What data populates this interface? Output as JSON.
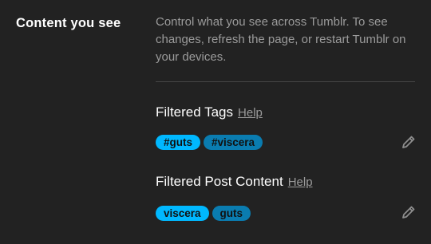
{
  "section": {
    "title": "Content you see",
    "description": "Control what you see across Tumblr. To see changes, refresh the page, or restart Tumblr on your devices."
  },
  "filtered_tags": {
    "label": "Filtered Tags",
    "help_label": "Help",
    "tags": [
      "#guts",
      "#viscera"
    ],
    "edit_icon": "pencil-icon"
  },
  "filtered_post_content": {
    "label": "Filtered Post Content",
    "help_label": "Help",
    "terms": [
      "viscera",
      "guts"
    ],
    "edit_icon": "pencil-icon"
  },
  "colors": {
    "background": "#222222",
    "chip_bright": "#00b8ff",
    "chip_dim": "#0a7cb0",
    "muted_text": "#9b9b9b"
  }
}
